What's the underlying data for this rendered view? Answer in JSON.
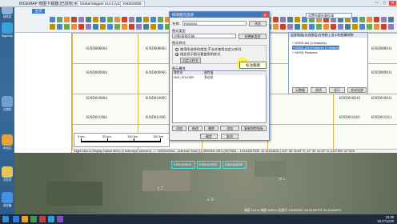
{
  "window": {
    "title": "BIGEMAP 地图下载器 [已授权:水经注]",
    "tab1": "Global Mapper v14.1 (v13",
    "tab2": "KNSD0006",
    "min": "—",
    "max": "□",
    "close": "✕"
  },
  "ribbon": {
    "home_tab": "主页"
  },
  "desktop_icons": [
    {
      "label": "回收站",
      "color": "#8fb3d9"
    },
    {
      "label": "Bigemap",
      "color": "#3aa0d8"
    },
    {
      "label": "计算机",
      "color": "#6fa0cf"
    },
    {
      "label": "水经注",
      "color": "#e8a23c"
    },
    {
      "label": "文件夹",
      "color": "#e6c65a"
    },
    {
      "label": "浏览器",
      "color": "#4a90e2"
    }
  ],
  "map": {
    "sheets": [
      {
        "id": "KND008004"
      },
      {
        "id": "KND008005"
      },
      {
        "id": "KND008006"
      },
      {
        "id": "KND008010"
      },
      {
        "id": "KND008011"
      },
      {
        "id": "KND009004"
      },
      {
        "id": "KND009005"
      },
      {
        "id": "KND009006"
      },
      {
        "id": "KND009010"
      },
      {
        "id": "KND009011"
      },
      {
        "id": "KND010004"
      },
      {
        "id": "KND010005"
      },
      {
        "id": "KND010006"
      },
      {
        "id": "KND010010"
      },
      {
        "id": "KND010011"
      },
      {
        "id": "KND011004"
      },
      {
        "id": "KND011005"
      },
      {
        "id": "KND011006"
      },
      {
        "id": "KND011010"
      },
      {
        "id": "KND011011"
      }
    ],
    "scale_labels": [
      "0 km",
      "50 km",
      "100 km",
      "150 km"
    ],
    "status": "Right Click to Display Option Menu (1 feature(s) selected) --> +53000000m-- Unknown Area (1)| 5599000 GEO (WGS84) -- 115.6426750E, 41.5116481N | 115° 38' 33.63\" E, 41° 30' 41.93\" N | 115°38'E 41°30'N",
    "sat_labels": [
      "北京",
      "天津",
      "唐山"
    ],
    "cyan_boxes": [
      "KND016004",
      "KND016005",
      "KND016006"
    ],
    "coords": "高程 141 m   海拔 1000 m   比例尺 1:8000000   115.642675°E 41.511648°N"
  },
  "dialog": {
    "title": "修改图元选项",
    "name_label": "名称:",
    "name_value": "R008004",
    "browse": "浏览",
    "feature_type_label": "图元类型",
    "feature_type_value": "边界(面状区域)",
    "create_new_type": "创建新类型",
    "style_label": "图元样式",
    "style_opt1": "使用所选择的类型,不允许使用自定义样式",
    "style_opt2": "指定显示图元要使用的样式",
    "custom_style": "自定义样式",
    "attr_label": "图元属性",
    "col_name": "属性名",
    "col_value": "属性值",
    "attr_row_name": "SKE_FOLDER",
    "attr_row_value": "多边形",
    "add": "添加",
    "edit": "修改",
    "delete": "删除",
    "add_from_file": "添加",
    "copy_to_clip": "复制到剪贴板",
    "ok": "确定",
    "cancel": "取消"
  },
  "tooltip": "标注截图",
  "search": {
    "value": "设置向量矢量区域"
  },
  "layers": {
    "header": "层管理器(勾选图层)在地图上显示和隐藏地物",
    "rows": [
      {
        "label": "+ KNSD Ark (1 features)",
        "selected": false
      },
      {
        "label": "+ KNSD (2d) Features (1 feature)",
        "selected": true
      },
      {
        "label": "+ KNSD Features",
        "selected": false
      }
    ],
    "buttons": [
      "元数据",
      "选项",
      "显示",
      "关闭全部"
    ]
  },
  "taskbar": {
    "time": "16:36",
    "date": "2017/11/25",
    "icons": [
      "#2a7de1",
      "#f0a020",
      "#3a9b4b",
      "#c83c3c",
      "#2aa4d6",
      "#7a4ec9"
    ]
  }
}
